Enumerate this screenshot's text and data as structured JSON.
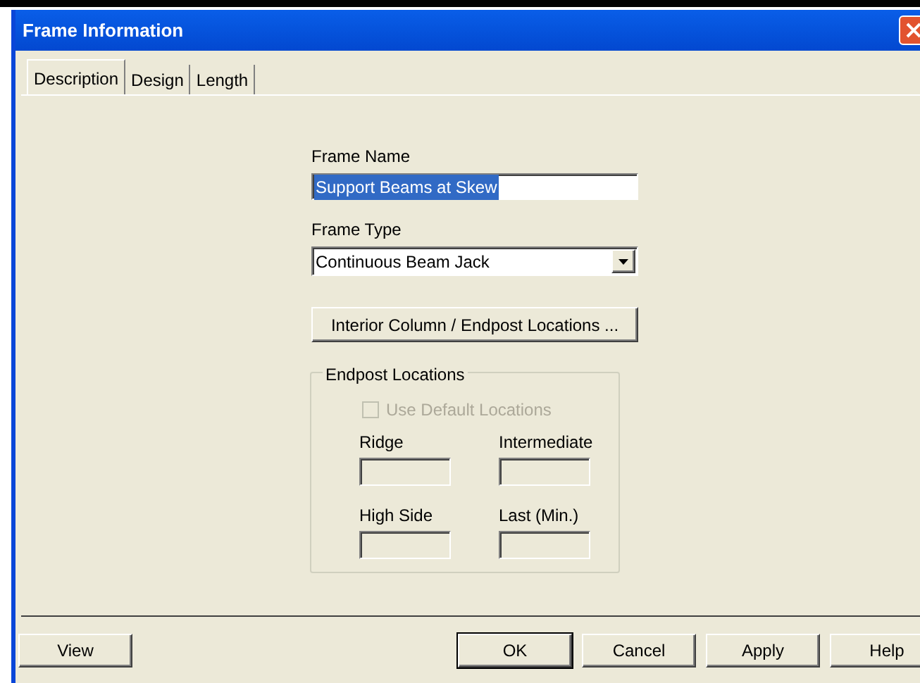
{
  "window": {
    "title": "Frame Information"
  },
  "tabs": [
    {
      "label": "Description",
      "selected": true
    },
    {
      "label": "Design",
      "selected": false
    },
    {
      "label": "Length",
      "selected": false
    }
  ],
  "frame_name": {
    "label": "Frame Name",
    "value": "Support Beams at Skew",
    "selected": true
  },
  "frame_type": {
    "label": "Frame Type",
    "value": "Continuous Beam Jack"
  },
  "locations_button": "Interior Column / Endpost Locations ...",
  "endpost_group": {
    "title": "Endpost Locations",
    "checkbox": {
      "label": "Use Default Locations",
      "checked": false,
      "disabled": true
    },
    "fields": [
      {
        "label": "Ridge",
        "disabled": true
      },
      {
        "label": "Intermediate",
        "disabled": true
      },
      {
        "label": "High Side",
        "disabled": true
      },
      {
        "label": "Last (Min.)",
        "disabled": true
      }
    ]
  },
  "buttons": [
    {
      "label": "View",
      "default": false
    },
    {
      "label": "OK",
      "default": true
    },
    {
      "label": "Cancel",
      "default": false
    },
    {
      "label": "Apply",
      "default": false
    },
    {
      "label": "Help",
      "default": false
    }
  ]
}
